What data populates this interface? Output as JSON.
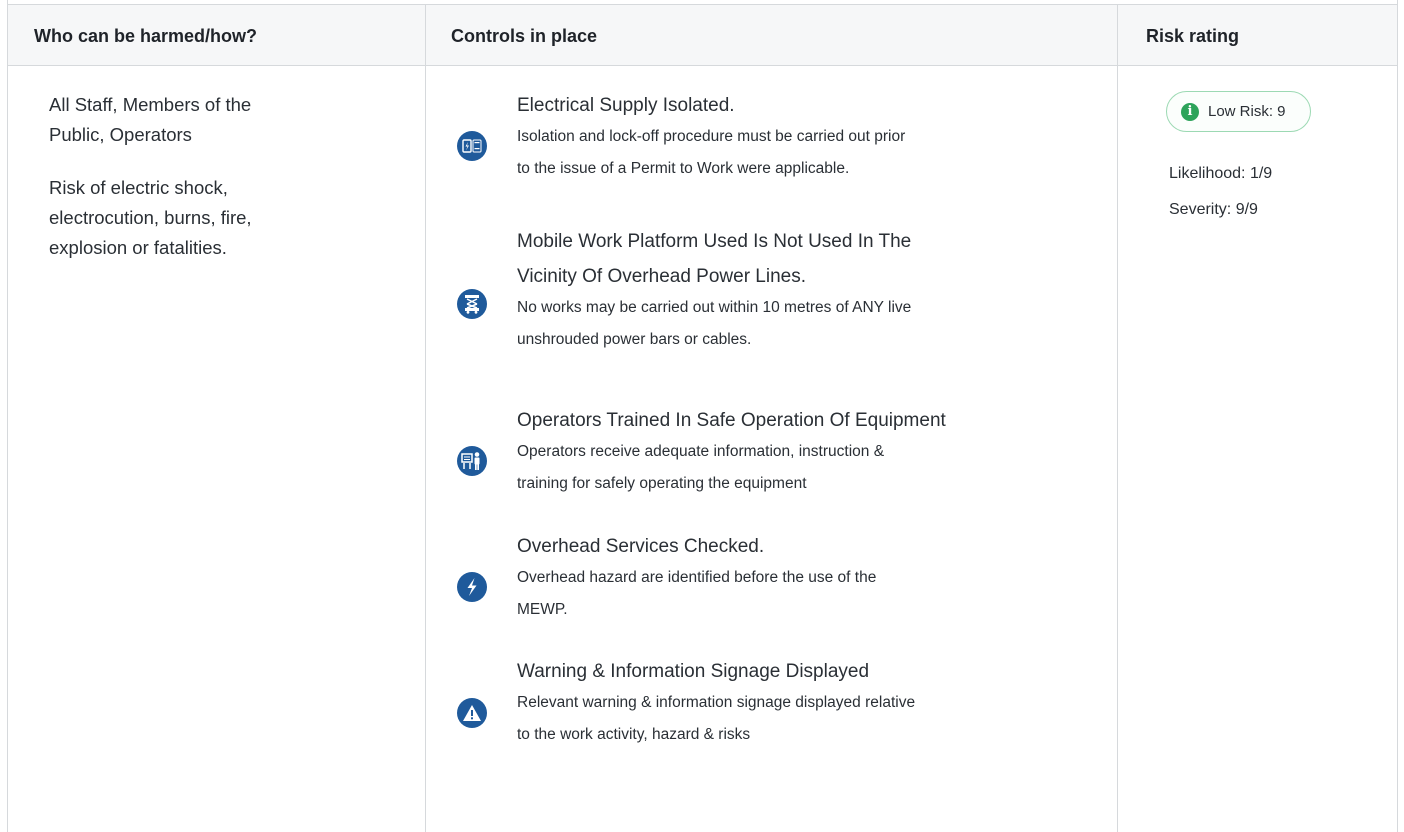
{
  "headers": {
    "who": "Who can be harmed/how?",
    "controls": "Controls in place",
    "risk": "Risk rating"
  },
  "who": {
    "people_line1": "All Staff, Members of the",
    "people_line2": "Public, Operators",
    "risk_line1": "Risk of electric shock,",
    "risk_line2": "electrocution, burns, fire,",
    "risk_line3": "explosion or fatalities."
  },
  "controls": [
    {
      "icon": "electrical-isolation-icon",
      "title": [
        "Electrical Supply Isolated."
      ],
      "desc": [
        "Isolation and lock-off procedure must be carried out prior",
        "to the issue of a Permit to Work were applicable."
      ]
    },
    {
      "icon": "mobile-platform-icon",
      "title": [
        "Mobile Work Platform Used Is Not Used In The",
        "Vicinity Of Overhead Power Lines."
      ],
      "desc": [
        "No works may be carried out within 10 metres of ANY live",
        "unshrouded power bars or cables."
      ]
    },
    {
      "icon": "training-icon",
      "title": [
        "Operators Trained In Safe Operation Of Equipment"
      ],
      "desc": [
        "Operators receive adequate information, instruction &",
        "training for safely operating the equipment"
      ]
    },
    {
      "icon": "lightning-icon",
      "title": [
        "Overhead Services Checked."
      ],
      "desc": [
        "Overhead hazard are identified before the use of the",
        "MEWP."
      ]
    },
    {
      "icon": "warning-triangle-icon",
      "title": [
        "Warning & Information Signage Displayed"
      ],
      "desc": [
        "Relevant warning & information signage displayed relative",
        "to the work activity, hazard & risks"
      ]
    }
  ],
  "risk": {
    "badge_label": "Low Risk: 9",
    "badge_icon": "info-icon",
    "badge_icon_glyph": "i",
    "likelihood": "Likelihood: 1/9",
    "severity": "Severity: 9/9"
  },
  "colors": {
    "icon_blue": "#1f5a9b",
    "badge_green": "#2da35a",
    "badge_border": "#9cd9b3",
    "header_bg": "#f6f7f8"
  }
}
